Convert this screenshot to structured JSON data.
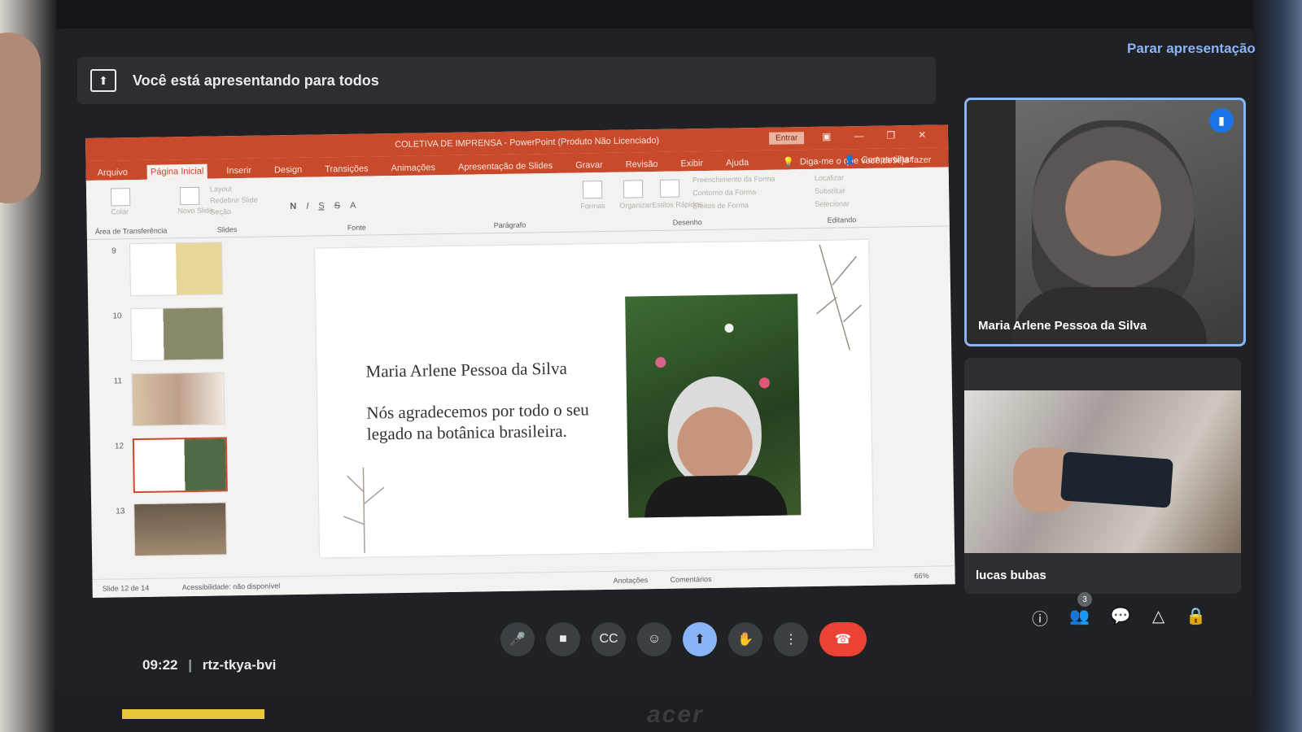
{
  "banner": {
    "text": "Você está apresentando para todos",
    "stop_label": "Parar apresentação"
  },
  "powerpoint": {
    "window_title": "COLETIVA DE IMPRENSA  -  PowerPoint (Produto Não Licenciado)",
    "signin_label": "Entrar",
    "tabs": [
      "Arquivo",
      "Página Inicial",
      "Inserir",
      "Design",
      "Transições",
      "Animações",
      "Apresentação de Slides",
      "Gravar",
      "Revisão",
      "Exibir",
      "Ajuda"
    ],
    "tell_me": "Diga-me o que você deseja fazer",
    "share_label": "Compartilhar",
    "ribbon_groups": {
      "clipboard": "Área de Transferência",
      "slides": "Slides",
      "font": "Fonte",
      "paragraph": "Parágrafo",
      "drawing": "Desenho",
      "editing": "Editando"
    },
    "ribbon_items": {
      "paste": "Colar",
      "new_slide": "Novo Slide",
      "layout": "Layout",
      "reset": "Redefinir Slide",
      "section": "Seção",
      "shapes": "Formas",
      "arrange": "Organizar",
      "quick_styles": "Estilos Rápidos",
      "fill": "Preenchimento da Forma",
      "outline": "Contorno da Forma",
      "effects": "Efeitos de Forma",
      "find": "Localizar",
      "replace": "Substituir",
      "select": "Selecionar"
    },
    "thumbnails": [
      "9",
      "10",
      "11",
      "12",
      "13"
    ],
    "slide": {
      "name": "Maria Arlene Pessoa da Silva",
      "message": "Nós agradecemos por todo o seu legado na botânica brasileira."
    },
    "status": {
      "slide_count": "Slide 12 de 14",
      "accessibility": "Acessibilidade: não disponível",
      "notes": "Anotações",
      "comments": "Comentários",
      "zoom": "66%"
    }
  },
  "participants": [
    {
      "name": "Maria Arlene Pessoa da Silva",
      "speaking": true
    },
    {
      "name": "lucas bubas",
      "speaking": false
    }
  ],
  "meeting": {
    "time": "09:22",
    "code": "rtz-tkya-bvi",
    "participant_count": "3"
  },
  "device_logo": "acer",
  "colors": {
    "accent": "#8ab4f8",
    "end_call": "#ea4335",
    "ppt_orange": "#c9492b"
  }
}
